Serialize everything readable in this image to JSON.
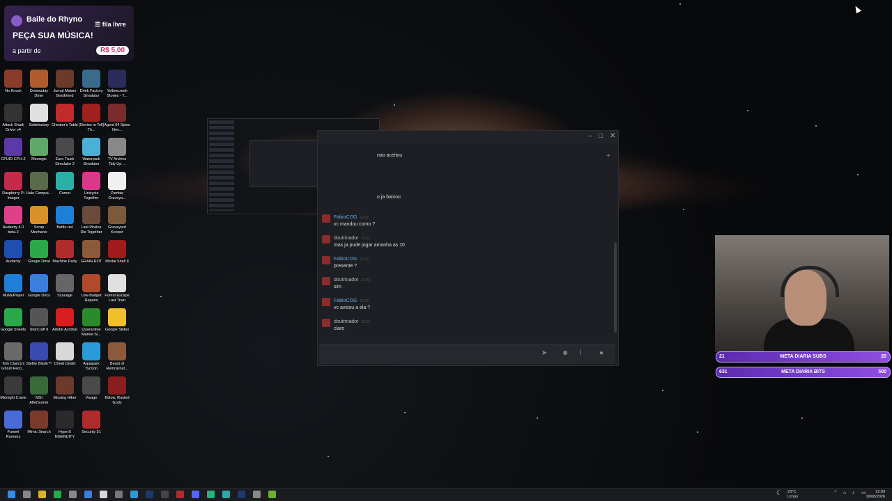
{
  "overlay": {
    "title": "Baile do Rhyno",
    "queue_label": "fila livre",
    "call_to_action": "PEÇA SUA MÚSICA!",
    "price_prefix": "a partir de",
    "price": "R$ 5,00"
  },
  "desktop_icons": [
    {
      "label": "No Knock",
      "color": "#8a3b2b"
    },
    {
      "label": "Doomsday Diner",
      "color": "#b15a2b"
    },
    {
      "label": "Jurnal Malam Bestfriend",
      "color": "#6b3a2a"
    },
    {
      "label": "Drink Factory Simulator",
      "color": "#3a6b8a"
    },
    {
      "label": "Yellowcreek Stories - T...",
      "color": "#2b2b5a"
    },
    {
      "label": "Attack Shark Driver v4",
      "color": "#333333"
    },
    {
      "label": "Satisfactory",
      "color": "#e0e0e0"
    },
    {
      "label": "Cheater's Table",
      "color": "#c22b2b"
    },
    {
      "label": "[Stories to Tell] Th...",
      "color": "#a02020"
    },
    {
      "label": "Agent 64 Spies Nev...",
      "color": "#7a2b2b"
    },
    {
      "label": "CPUID CPU-Z",
      "color": "#5b3aa8"
    },
    {
      "label": "Meowgic",
      "color": "#5fa86a"
    },
    {
      "label": "Euro Truck Simulator 2",
      "color": "#4a4a4a"
    },
    {
      "label": "Waterpark Simulator",
      "color": "#4ab0d8"
    },
    {
      "label": "TV Archive Tidy Up ...",
      "color": "#888888"
    },
    {
      "label": "Raspberry Pi Imager",
      "color": "#c22b4a"
    },
    {
      "label": "Halo Campai...",
      "color": "#5a6a4a"
    },
    {
      "label": "Comet",
      "color": "#2bb0a8"
    },
    {
      "label": "Unicycle Together",
      "color": "#d83a8a"
    },
    {
      "label": "Zombie Graveya...",
      "color": "#f0f0f0"
    },
    {
      "label": "Audacity 4.0 beta.2",
      "color": "#e0408a"
    },
    {
      "label": "Scrap Mechanic",
      "color": "#d8902b"
    },
    {
      "label": "Battle.net",
      "color": "#1e7fd8"
    },
    {
      "label": "Last Pirates Die Together",
      "color": "#6a4a3a"
    },
    {
      "label": "Graveyard Keeper",
      "color": "#7a5a3a"
    },
    {
      "label": "Audacity",
      "color": "#1e4fb0"
    },
    {
      "label": "Google Drive",
      "color": "#2ba84a"
    },
    {
      "label": "Machine Party",
      "color": "#b02b2b"
    },
    {
      "label": "GRAIN ROT",
      "color": "#8a5a3a"
    },
    {
      "label": "Mortal Shell II",
      "color": "#a01b1b"
    },
    {
      "label": "MuMuPlayer",
      "color": "#1e7fd8"
    },
    {
      "label": "Google Docs",
      "color": "#3a7fe0"
    },
    {
      "label": "Scauage",
      "color": "#666666"
    },
    {
      "label": "Low-Budget Repairs",
      "color": "#b04a2b"
    },
    {
      "label": "Forest Escape Last Train",
      "color": "#e0e0e0"
    },
    {
      "label": "Google Sheets",
      "color": "#2ba84a"
    },
    {
      "label": "StarCraft II",
      "color": "#555555"
    },
    {
      "label": "Adobe Acrobat",
      "color": "#d81e1e"
    },
    {
      "label": "Quarantine Market Si...",
      "color": "#2b8a2b"
    },
    {
      "label": "Google Slides",
      "color": "#f0c02b"
    },
    {
      "label": "Tom Clancy's Ghost Reco...",
      "color": "#6a6a6a"
    },
    {
      "label": "Stellar Blade™",
      "color": "#3a4ab0"
    },
    {
      "label": "Cheat Death",
      "color": "#d8d8d8"
    },
    {
      "label": "Aquapark Tycoon",
      "color": "#2b9ad8"
    },
    {
      "label": "Beast of Reincarnat...",
      "color": "#8a5a3a"
    },
    {
      "label": "Midnight Crane",
      "color": "#3a3a3a"
    },
    {
      "label": "MSI Afterburner",
      "color": "#3a6a3a"
    },
    {
      "label": "Missing Hiker",
      "color": "#6a3a2b"
    },
    {
      "label": "Visage",
      "color": "#4a4a4a"
    },
    {
      "label": "Below, Rusted Gods",
      "color": "#8a1e1e"
    },
    {
      "label": "Funnel Runners",
      "color": "#4a6ad8"
    },
    {
      "label": "Mimic Search",
      "color": "#7a3a2b"
    },
    {
      "label": "HyperX NGENUITY",
      "color": "#2b2b2b"
    },
    {
      "label": "Security 51",
      "color": "#b02b2b"
    }
  ],
  "chat": {
    "partial_lines": [
      "nao aceitou",
      "o ja baixou"
    ],
    "messages": [
      {
        "name": "FabioCOG",
        "time": "22:22",
        "text": "vc mandou como ?",
        "blue": true
      },
      {
        "name": "doutrinador",
        "time": "22:22",
        "text": "mas ja pode jogar amanha as 10",
        "blue": false
      },
      {
        "name": "FabioCOG",
        "time": "22:22",
        "text": "presente ?",
        "blue": true
      },
      {
        "name": "doutrinador",
        "time": "22:22",
        "text": "sim",
        "blue": false
      },
      {
        "name": "FabioCOG",
        "time": "22:22",
        "text": "vc avisou a ela ?",
        "blue": true
      },
      {
        "name": "doutrinador",
        "time": "22:22",
        "text": "claro",
        "blue": false
      }
    ],
    "composer_placeholder": ""
  },
  "goals": [
    {
      "left": "21",
      "label": "META DIARIA SUBS",
      "right": "20"
    },
    {
      "left": "631",
      "label": "META DIARIA BITS",
      "right": "500"
    }
  ],
  "taskbar": {
    "weather_temp": "23°C",
    "weather_desc": "Limpo",
    "time": "22:09",
    "date": "16/08/2026"
  }
}
